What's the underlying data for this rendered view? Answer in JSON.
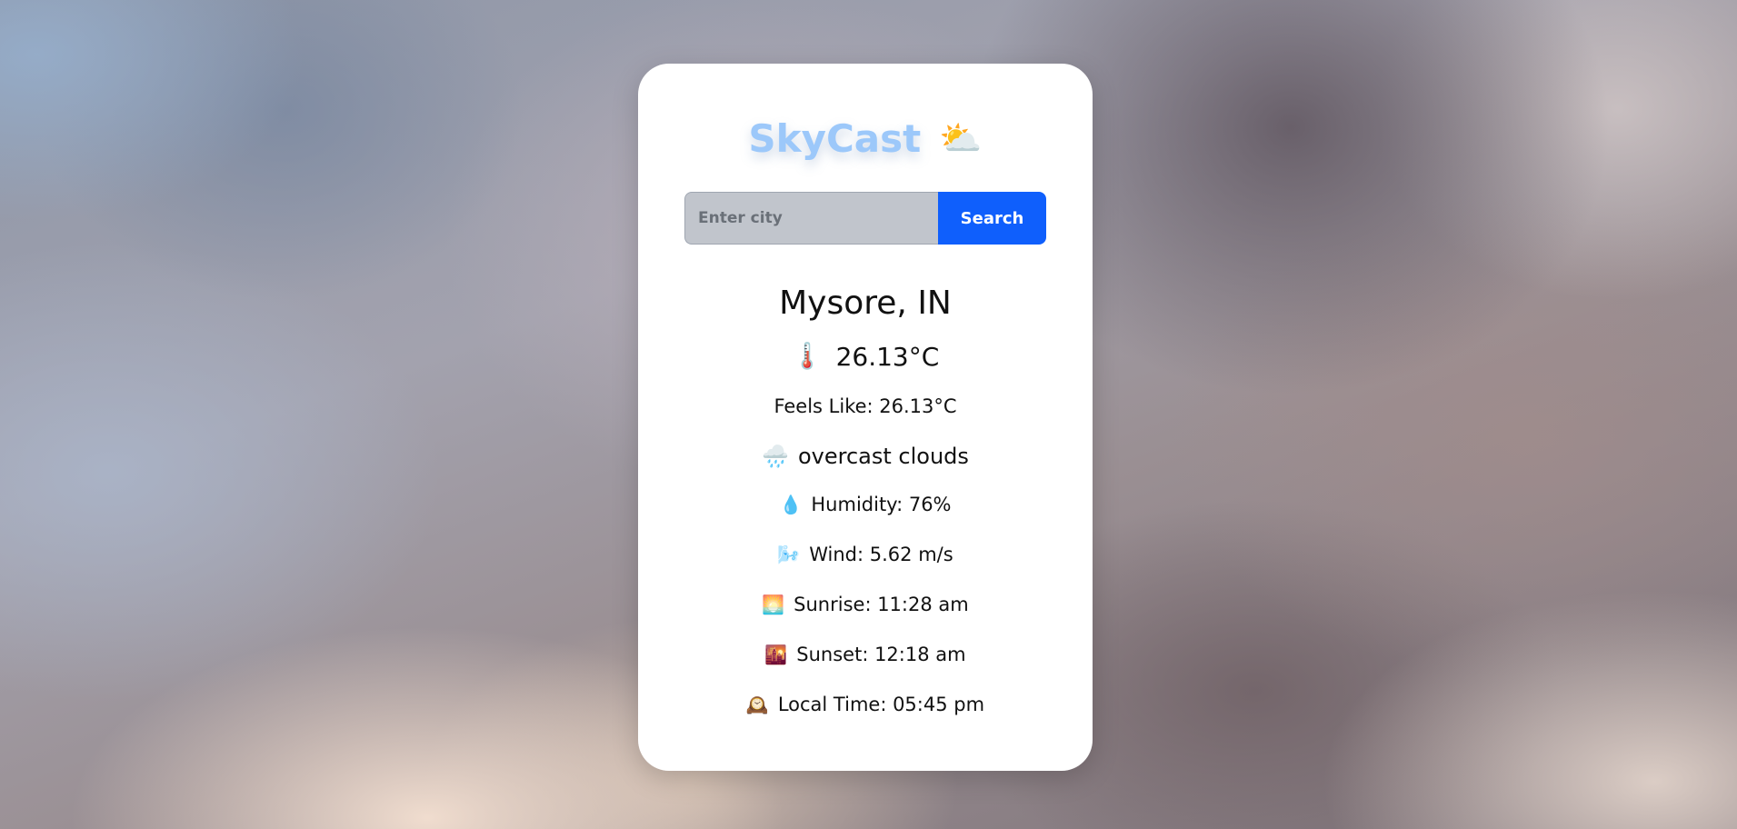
{
  "app": {
    "title": "SkyCast",
    "title_icon": "⛅"
  },
  "search": {
    "placeholder": "Enter city",
    "value": "",
    "button_label": "Search"
  },
  "weather": {
    "location": "Mysore, IN",
    "temperature": "26.13°C",
    "temperature_icon": "🌡️",
    "feels_like": "Feels Like: 26.13°C",
    "description": "overcast clouds",
    "description_icon": "🌧️",
    "humidity": "Humidity: 76%",
    "humidity_icon": "💧",
    "wind": "Wind: 5.62 m/s",
    "wind_icon": "🌬️",
    "sunrise": "Sunrise: 11:28 am",
    "sunrise_icon": "🌅",
    "sunset": "Sunset: 12:18 am",
    "sunset_icon": "🌇",
    "local_time": "Local Time: 05:45 pm",
    "local_time_icon": "🕰️"
  },
  "colors": {
    "title": "#9cc8fa",
    "button": "#0f5ffc",
    "input_bg": "#c1c5cc",
    "card_bg": "#ffffff"
  }
}
